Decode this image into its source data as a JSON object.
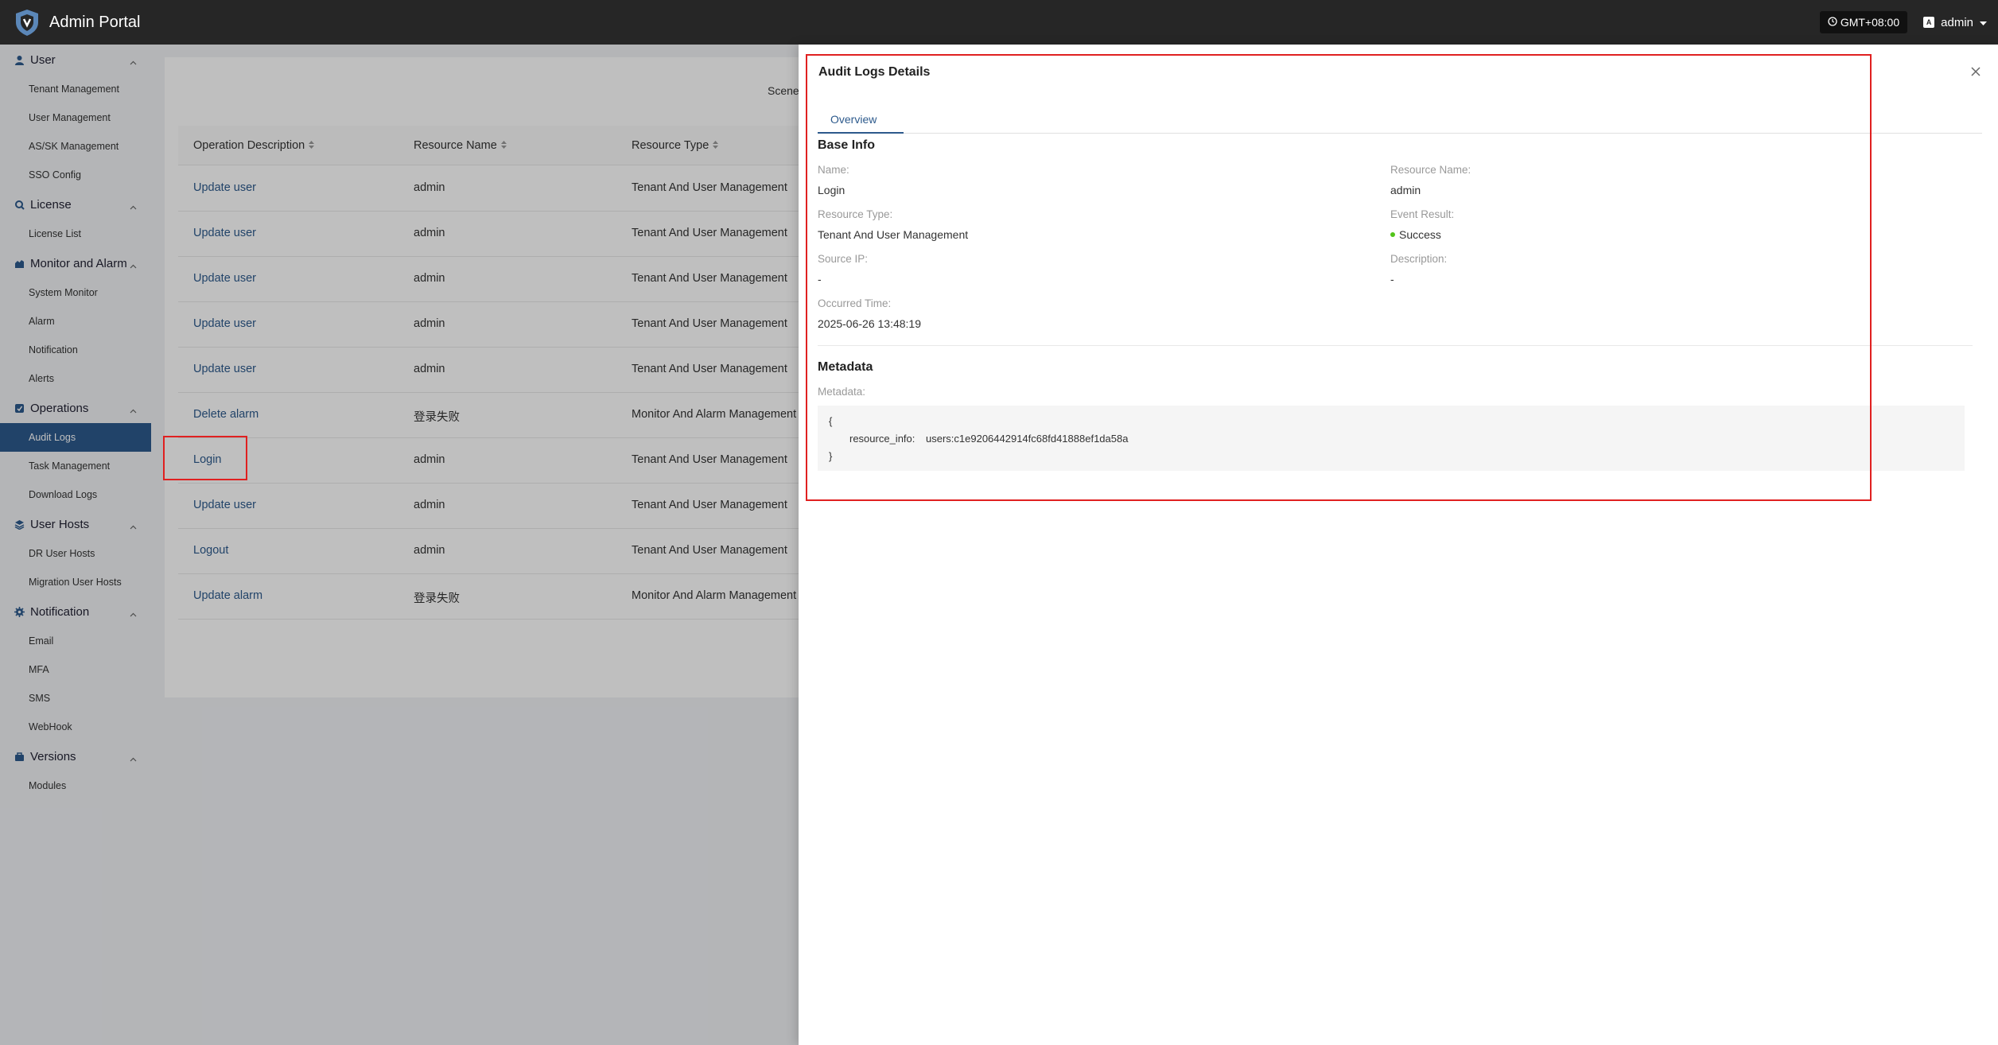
{
  "header": {
    "app_title": "Admin Portal",
    "timezone": "GMT+08:00",
    "user_name": "admin",
    "user_badge": "A"
  },
  "sidebar": {
    "groups": [
      {
        "label": "User",
        "icon": "user-icon",
        "items": [
          "Tenant Management",
          "User Management",
          "AS/SK Management",
          "SSO Config"
        ]
      },
      {
        "label": "License",
        "icon": "license-icon",
        "items": [
          "License List"
        ]
      },
      {
        "label": "Monitor and Alarm",
        "icon": "monitor-icon",
        "items": [
          "System Monitor",
          "Alarm",
          "Notification",
          "Alerts"
        ]
      },
      {
        "label": "Operations",
        "icon": "operations-icon",
        "items": [
          "Audit Logs",
          "Task Management",
          "Download Logs"
        ]
      },
      {
        "label": "User Hosts",
        "icon": "hosts-icon",
        "items": [
          "DR User Hosts",
          "Migration User Hosts"
        ]
      },
      {
        "label": "Notification",
        "icon": "gear-icon",
        "items": [
          "Email",
          "MFA",
          "SMS",
          "WebHook"
        ]
      },
      {
        "label": "Versions",
        "icon": "versions-icon",
        "items": [
          "Modules"
        ]
      }
    ],
    "active_item": "Audit Logs"
  },
  "main": {
    "scene_label": "Scene",
    "columns": [
      "Operation Description",
      "Resource Name",
      "Resource Type"
    ],
    "rows": [
      [
        "Update user",
        "admin",
        "Tenant And User Management"
      ],
      [
        "Update user",
        "admin",
        "Tenant And User Management"
      ],
      [
        "Update user",
        "admin",
        "Tenant And User Management"
      ],
      [
        "Update user",
        "admin",
        "Tenant And User Management"
      ],
      [
        "Update user",
        "admin",
        "Tenant And User Management"
      ],
      [
        "Delete alarm",
        "登录失败",
        "Monitor And Alarm Management"
      ],
      [
        "Login",
        "admin",
        "Tenant And User Management"
      ],
      [
        "Update user",
        "admin",
        "Tenant And User Management"
      ],
      [
        "Logout",
        "admin",
        "Tenant And User Management"
      ],
      [
        "Update alarm",
        "登录失败",
        "Monitor And Alarm Management"
      ]
    ]
  },
  "drawer": {
    "title": "Audit Logs Details",
    "tab": "Overview",
    "base_info_title": "Base Info",
    "fields": {
      "name_label": "Name:",
      "name_value": "Login",
      "resource_name_label": "Resource Name:",
      "resource_name_value": "admin",
      "resource_type_label": "Resource Type:",
      "resource_type_value": "Tenant And User Management",
      "event_result_label": "Event Result:",
      "event_result_value": "Success",
      "source_ip_label": "Source IP:",
      "source_ip_value": "-",
      "description_label": "Description:",
      "description_value": "-",
      "occurred_time_label": "Occurred Time:",
      "occurred_time_value": "2025-06-26 13:48:19"
    },
    "metadata_title": "Metadata",
    "metadata_label": "Metadata:",
    "metadata_open": "{",
    "metadata_key": "resource_info:",
    "metadata_value": "users:c1e9206442914fc68fd41888ef1da58a",
    "metadata_close": "}"
  },
  "colors": {
    "accent": "#2d5a8c",
    "success": "#52c41a",
    "highlight": "#e02020",
    "topbar": "#262626"
  }
}
